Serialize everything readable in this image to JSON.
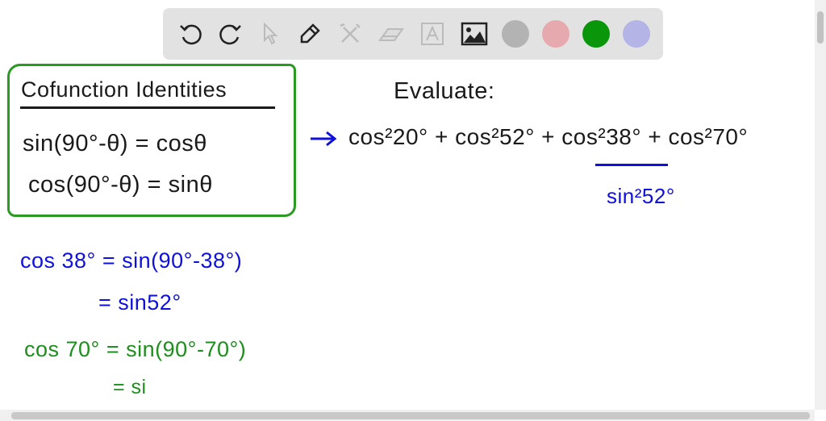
{
  "toolbar": {
    "tools": [
      "undo-icon",
      "redo-icon",
      "select-icon",
      "pen-icon",
      "tools-icon",
      "eraser-icon",
      "text-icon",
      "image-icon"
    ],
    "colors": [
      "#b3b3b3",
      "#e6a9ae",
      "#0a960a",
      "#b4b4e6"
    ]
  },
  "board": {
    "identities_title": "Cofunction Identities",
    "identity_1": "sin(90°-θ) = cosθ",
    "identity_2": "cos(90°-θ) = sinθ",
    "evaluate_label": "Evaluate:",
    "expression": "cos²20° + cos²52° + cos²38° + cos²70°",
    "substitution": "sin²52°",
    "step1_line1": "cos 38° = sin(90°-38°)",
    "step1_line2": "= sin52°",
    "step2_line1": "cos 70° = sin(90°-70°)",
    "step2_line2": "= si"
  },
  "ink_colors": {
    "black": "#1a1a1a",
    "blue": "#1010dd",
    "green": "#1c8f1c"
  }
}
